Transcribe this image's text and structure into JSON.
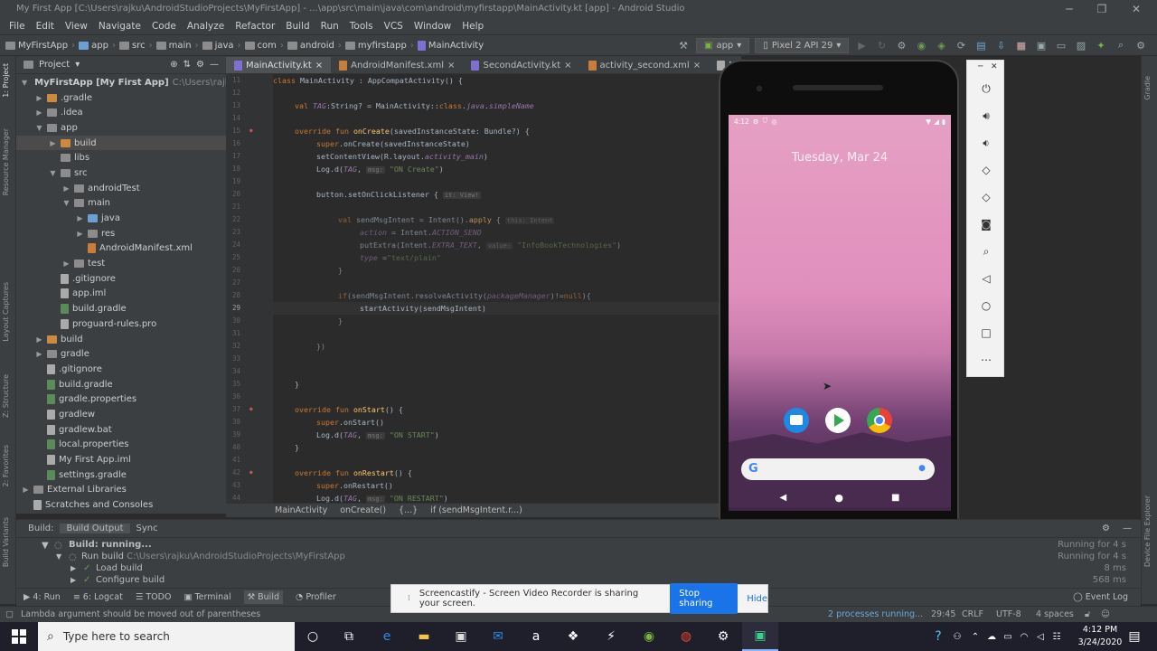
{
  "window": {
    "title": "My First App [C:\\Users\\rajku\\AndroidStudioProjects\\MyFirstApp] - ...\\app\\src\\main\\java\\com\\android\\myfirstapp\\MainActivity.kt [app] - Android Studio"
  },
  "menu": [
    "File",
    "Edit",
    "View",
    "Navigate",
    "Code",
    "Analyze",
    "Refactor",
    "Build",
    "Run",
    "Tools",
    "VCS",
    "Window",
    "Help"
  ],
  "nav": {
    "crumbs": [
      "MyFirstApp",
      "app",
      "src",
      "main",
      "java",
      "com",
      "android",
      "myfirstapp",
      "MainActivity"
    ],
    "run_config": "app",
    "device": "Pixel 2 API 29"
  },
  "left_stripe": [
    "1: Project",
    "Resource Manager",
    "Layout Captures",
    "Z: Structure",
    "2: Favorites",
    "Build Variants"
  ],
  "right_stripe": [
    "Gradle",
    "Device File Explorer"
  ],
  "project": {
    "header": "Project",
    "items": [
      {
        "label": "MyFirstApp [My First App]",
        "extra": "C:\\Users\\rajku\\A",
        "indent": 0,
        "arrow": "▼",
        "icon": "folder"
      },
      {
        "label": ".gradle",
        "indent": 1,
        "arrow": "▶",
        "icon": "orange"
      },
      {
        "label": ".idea",
        "indent": 1,
        "arrow": "▶",
        "icon": "folder"
      },
      {
        "label": "app",
        "indent": 1,
        "arrow": "▼",
        "icon": "folder"
      },
      {
        "label": "build",
        "indent": 2,
        "arrow": "▶",
        "icon": "orange",
        "selected": true
      },
      {
        "label": "libs",
        "indent": 2,
        "arrow": "",
        "icon": "folder"
      },
      {
        "label": "src",
        "indent": 2,
        "arrow": "▼",
        "icon": "folder"
      },
      {
        "label": "androidTest",
        "indent": 3,
        "arrow": "▶",
        "icon": "folder"
      },
      {
        "label": "main",
        "indent": 3,
        "arrow": "▼",
        "icon": "folder"
      },
      {
        "label": "java",
        "indent": 4,
        "arrow": "▶",
        "icon": "blue"
      },
      {
        "label": "res",
        "indent": 4,
        "arrow": "▶",
        "icon": "folder"
      },
      {
        "label": "AndroidManifest.xml",
        "indent": 4,
        "arrow": "",
        "icon": "xml"
      },
      {
        "label": "test",
        "indent": 3,
        "arrow": "▶",
        "icon": "folder"
      },
      {
        "label": ".gitignore",
        "indent": 2,
        "arrow": "",
        "icon": "file"
      },
      {
        "label": "app.iml",
        "indent": 2,
        "arrow": "",
        "icon": "file"
      },
      {
        "label": "build.gradle",
        "indent": 2,
        "arrow": "",
        "icon": "gradle"
      },
      {
        "label": "proguard-rules.pro",
        "indent": 2,
        "arrow": "",
        "icon": "file"
      },
      {
        "label": "build",
        "indent": 1,
        "arrow": "▶",
        "icon": "orange"
      },
      {
        "label": "gradle",
        "indent": 1,
        "arrow": "▶",
        "icon": "folder"
      },
      {
        "label": ".gitignore",
        "indent": 1,
        "arrow": "",
        "icon": "file"
      },
      {
        "label": "build.gradle",
        "indent": 1,
        "arrow": "",
        "icon": "gradle"
      },
      {
        "label": "gradle.properties",
        "indent": 1,
        "arrow": "",
        "icon": "gradle"
      },
      {
        "label": "gradlew",
        "indent": 1,
        "arrow": "",
        "icon": "file"
      },
      {
        "label": "gradlew.bat",
        "indent": 1,
        "arrow": "",
        "icon": "file"
      },
      {
        "label": "local.properties",
        "indent": 1,
        "arrow": "",
        "icon": "gradle"
      },
      {
        "label": "My First App.iml",
        "indent": 1,
        "arrow": "",
        "icon": "file"
      },
      {
        "label": "settings.gradle",
        "indent": 1,
        "arrow": "",
        "icon": "gradle"
      },
      {
        "label": "External Libraries",
        "indent": 0,
        "arrow": "▶",
        "icon": "folder"
      },
      {
        "label": "Scratches and Consoles",
        "indent": 0,
        "arrow": "",
        "icon": "file"
      }
    ]
  },
  "tabs": [
    {
      "label": "MainActivity.kt",
      "icon": "kt",
      "active": true
    },
    {
      "label": "AndroidManifest.xml",
      "icon": "xml"
    },
    {
      "label": "SecondActivity.kt",
      "icon": "kt"
    },
    {
      "label": "activity_second.xml",
      "icon": "xml"
    },
    {
      "label": "My First Ac",
      "icon": "file"
    }
  ],
  "code": {
    "line_numbers": [
      "11",
      "12",
      "13",
      "14",
      "15",
      "16",
      "17",
      "18",
      "19",
      "20",
      "21",
      "22",
      "23",
      "24",
      "25",
      "26",
      "27",
      "28",
      "29",
      "30",
      "31",
      "32",
      "33",
      "34",
      "35",
      "36",
      "37",
      "38",
      "39",
      "40",
      "41",
      "42",
      "43",
      "44"
    ],
    "lines": [
      {
        "parts": [
          [
            "kw",
            "class "
          ],
          [
            "plain",
            "MainActivity : AppCompatActivity() {"
          ]
        ],
        "indent": 0
      },
      {
        "parts": [],
        "indent": 0
      },
      {
        "parts": [
          [
            "kw",
            "val "
          ],
          [
            "it",
            "TAG"
          ],
          [
            "plain",
            ":String? = MainActivity::"
          ],
          [
            "kw",
            "class"
          ],
          [
            "plain",
            "."
          ],
          [
            "it",
            "java"
          ],
          [
            "plain",
            "."
          ],
          [
            "it",
            "simpleName"
          ]
        ],
        "indent": 1
      },
      {
        "parts": [],
        "indent": 0
      },
      {
        "parts": [
          [
            "kw",
            "override fun "
          ],
          [
            "fn",
            "onCreate"
          ],
          [
            "plain",
            "(savedInstanceState: Bundle?) {"
          ]
        ],
        "indent": 1
      },
      {
        "parts": [
          [
            "kw",
            "super"
          ],
          [
            "plain",
            ".onCreate(savedInstanceState)"
          ]
        ],
        "indent": 2
      },
      {
        "parts": [
          [
            "plain",
            "setContentView(R.layout."
          ],
          [
            "it",
            "activity_main"
          ],
          [
            "plain",
            ")"
          ]
        ],
        "indent": 2
      },
      {
        "parts": [
          [
            "plain",
            "Log.d("
          ],
          [
            "it",
            "TAG"
          ],
          [
            "plain",
            ", "
          ],
          [
            "hint",
            "msg:"
          ],
          [
            "str",
            " \"ON Create\""
          ],
          [
            "plain",
            ")"
          ]
        ],
        "indent": 2
      },
      {
        "parts": [],
        "indent": 0
      },
      {
        "parts": [
          [
            "plain",
            "button.setOnClickListener { "
          ],
          [
            "hint",
            "it: View!"
          ]
        ],
        "indent": 2
      },
      {
        "parts": [],
        "indent": 0
      },
      {
        "parts": [
          [
            "kw",
            "val "
          ],
          [
            "plain",
            "sendMsgIntent = Intent()."
          ],
          [
            "fn",
            "apply"
          ],
          [
            "plain",
            " { "
          ],
          [
            "hint",
            "this: Intent"
          ]
        ],
        "indent": 3,
        "dim": true
      },
      {
        "parts": [
          [
            "it",
            "action"
          ],
          [
            "plain",
            " = Intent."
          ],
          [
            "it",
            "ACTION_SEND"
          ]
        ],
        "indent": 4,
        "dim": true
      },
      {
        "parts": [
          [
            "plain",
            "putExtra(Intent."
          ],
          [
            "it",
            "EXTRA_TEXT"
          ],
          [
            "plain",
            ", "
          ],
          [
            "hint",
            "value:"
          ],
          [
            "str",
            " \"InfoBookTechnologies\""
          ],
          [
            "plain",
            ")"
          ]
        ],
        "indent": 4,
        "dim": true
      },
      {
        "parts": [
          [
            "it",
            "type"
          ],
          [
            "plain",
            " ="
          ],
          [
            "str",
            "\"text/plain\""
          ]
        ],
        "indent": 4,
        "dim": true
      },
      {
        "parts": [
          [
            "plain",
            "}"
          ]
        ],
        "indent": 3,
        "dim": true
      },
      {
        "parts": [],
        "indent": 0
      },
      {
        "parts": [
          [
            "kw",
            "if"
          ],
          [
            "plain",
            "(sendMsgIntent.resolveActivity("
          ],
          [
            "it",
            "packageManager"
          ],
          [
            "plain",
            ")!="
          ],
          [
            "kw",
            "null"
          ],
          [
            "plain",
            "){"
          ]
        ],
        "indent": 3,
        "dim": true
      },
      {
        "parts": [
          [
            "plain",
            "startActivity(sendMsgIntent)"
          ]
        ],
        "indent": 4
      },
      {
        "parts": [
          [
            "plain",
            "}"
          ]
        ],
        "indent": 3,
        "dim": true
      },
      {
        "parts": [],
        "indent": 0
      },
      {
        "parts": [
          [
            "plain",
            "})"
          ]
        ],
        "indent": 2,
        "dim": true
      },
      {
        "parts": [],
        "indent": 0
      },
      {
        "parts": [],
        "indent": 0
      },
      {
        "parts": [
          [
            "plain",
            "}"
          ]
        ],
        "indent": 1
      },
      {
        "parts": [],
        "indent": 0
      },
      {
        "parts": [
          [
            "kw",
            "override fun "
          ],
          [
            "fn",
            "onStart"
          ],
          [
            "plain",
            "() {"
          ]
        ],
        "indent": 1
      },
      {
        "parts": [
          [
            "kw",
            "super"
          ],
          [
            "plain",
            ".onStart()"
          ]
        ],
        "indent": 2
      },
      {
        "parts": [
          [
            "plain",
            "Log.d("
          ],
          [
            "it",
            "TAG"
          ],
          [
            "plain",
            ", "
          ],
          [
            "hint",
            "msg:"
          ],
          [
            "str",
            " \"ON START\""
          ],
          [
            "plain",
            ")"
          ]
        ],
        "indent": 2
      },
      {
        "parts": [
          [
            "plain",
            "}"
          ]
        ],
        "indent": 1
      },
      {
        "parts": [],
        "indent": 0
      },
      {
        "parts": [
          [
            "kw",
            "override fun "
          ],
          [
            "fn",
            "onRestart"
          ],
          [
            "plain",
            "() {"
          ]
        ],
        "indent": 1
      },
      {
        "parts": [
          [
            "kw",
            "super"
          ],
          [
            "plain",
            ".onRestart()"
          ]
        ],
        "indent": 2
      },
      {
        "parts": [
          [
            "plain",
            "Log.d("
          ],
          [
            "it",
            "TAG"
          ],
          [
            "plain",
            ", "
          ],
          [
            "hint",
            "msg:"
          ],
          [
            "str",
            " \"ON RESTART\""
          ],
          [
            "plain",
            ")"
          ]
        ],
        "indent": 2
      }
    ]
  },
  "code_breadcrumbs": [
    "MainActivity",
    "onCreate()",
    "{...}",
    "if (sendMsgIntent.r...)"
  ],
  "emulator": {
    "time": "4:12",
    "date": "Tuesday, Mar 24",
    "tools": [
      "power-icon",
      "volume-up-icon",
      "volume-down-icon",
      "rotate-left-icon",
      "rotate-right-icon",
      "camera-icon",
      "zoom-icon",
      "back-icon",
      "home-icon",
      "overview-icon",
      "more-icon"
    ]
  },
  "build": {
    "tabs": [
      "Build:",
      "Build Output",
      "Sync"
    ],
    "lines": [
      {
        "text": "Build: running...",
        "bold": true
      },
      {
        "text": "Run build",
        "extra": "C:\\Users\\rajku\\AndroidStudioProjects\\MyFirstApp"
      },
      {
        "text": "Load build"
      },
      {
        "text": "Configure build"
      }
    ],
    "timings": [
      "Running for 4 s",
      "Running for 4 s",
      "8 ms",
      "568 ms"
    ]
  },
  "toolwindows": [
    "4: Run",
    "6: Logcat",
    "TODO",
    "Terminal",
    "Build",
    "Profiler"
  ],
  "event_log": "Event Log",
  "status": {
    "message": "Lambda argument should be moved out of parentheses",
    "processes": "2 processes running...",
    "position": "29:45",
    "line_sep": "CRLF",
    "encoding": "UTF-8",
    "indent": "4 spaces"
  },
  "screencastify": {
    "message": "Screencastify - Screen Video Recorder is sharing your screen.",
    "stop": "Stop sharing",
    "hide": "Hide"
  },
  "taskbar": {
    "search_placeholder": "Type here to search",
    "time": "4:12 PM",
    "date": "3/24/2020"
  }
}
